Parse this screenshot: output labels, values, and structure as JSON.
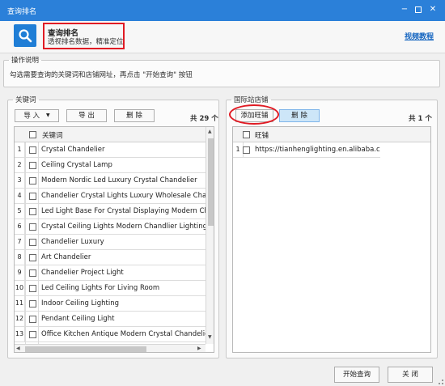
{
  "window": {
    "title": "查询排名",
    "minimize": "−",
    "close": "✕"
  },
  "header": {
    "title": "查询排名",
    "subtitle": "透视排名数据，精准定位",
    "video_link": "视频教程"
  },
  "instructions": {
    "legend": "操作说明",
    "text": "勾选需要查询的关键词和店铺网址，再点击 \"开始查询\" 按钮"
  },
  "keywords": {
    "legend": "关键词",
    "import_label": "导 入",
    "export_label": "导 出",
    "delete_label": "删 除",
    "total": "共 29 个",
    "column": "关键词",
    "rows": [
      {
        "n": "1",
        "text": "Crystal Chandelier"
      },
      {
        "n": "2",
        "text": "Ceiling Crystal Lamp"
      },
      {
        "n": "3",
        "text": "Modern Nordic Led Luxury Crystal Chandelier"
      },
      {
        "n": "4",
        "text": "Chandelier Crystal Lights Luxury Wholesale Chande"
      },
      {
        "n": "5",
        "text": "Led Light Base For Crystal Displaying Modern Chan"
      },
      {
        "n": "6",
        "text": "Crystal Ceiling Lights Modern Chandlier Lighting M"
      },
      {
        "n": "7",
        "text": "Chandelier Luxury"
      },
      {
        "n": "8",
        "text": "Art Chandelier"
      },
      {
        "n": "9",
        "text": "Chandelier Project Light"
      },
      {
        "n": "10",
        "text": "Led Ceiling Lights For Living Room"
      },
      {
        "n": "11",
        "text": "Indoor Ceiling Lighting"
      },
      {
        "n": "12",
        "text": "Pendant Ceiling Light"
      },
      {
        "n": "13",
        "text": "Office Kitchen Antique Modern Crystal Chandelier"
      }
    ]
  },
  "intl_shops": {
    "legend": "国际站店铺",
    "add_label": "添加旺铺",
    "delete_label": "删 除",
    "total": "共 1 个",
    "column": "旺铺",
    "rows": [
      {
        "n": "1",
        "text": "https://tianhenglighting.en.alibaba.com"
      }
    ]
  },
  "footer": {
    "start_label": "开始查询",
    "close_label": "关 闭"
  },
  "colors": {
    "titlebar": "#2b80d9",
    "highlight": "#e01b24",
    "link": "#1565c0",
    "accent": "#1f7ed6"
  }
}
